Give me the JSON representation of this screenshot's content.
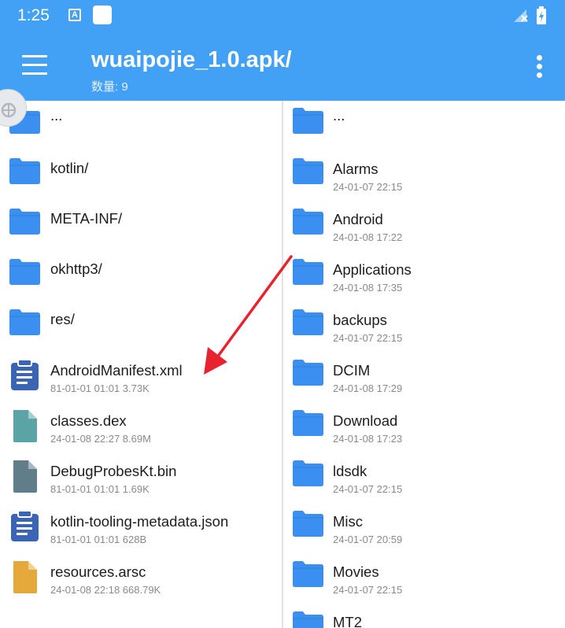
{
  "status": {
    "time": "1:25",
    "notif_letter": "A"
  },
  "appbar": {
    "title": "wuaipojie_1.0.apk/",
    "count": "数量: 9"
  },
  "colors": {
    "bar": "#42a0f5",
    "folder": "#3b8ff0",
    "xml": "#3a64b4",
    "dex": "#5aa4a6",
    "bin": "#607d8a",
    "arsc": "#e4a83b",
    "arrow": "#e8232f"
  },
  "left_pane": [
    {
      "name": "...",
      "meta": "",
      "icon": "folder-icon"
    },
    {
      "name": "kotlin/",
      "meta": "",
      "icon": "folder-icon"
    },
    {
      "name": "META-INF/",
      "meta": "",
      "icon": "folder-icon"
    },
    {
      "name": "okhttp3/",
      "meta": "",
      "icon": "folder-icon"
    },
    {
      "name": "res/",
      "meta": "",
      "icon": "folder-icon"
    },
    {
      "name": "AndroidManifest.xml",
      "meta": "81-01-01 01:01  3.73K",
      "icon": "xml-clipboard-icon"
    },
    {
      "name": "classes.dex",
      "meta": "24-01-08 22:27  8.69M",
      "icon": "dex-file-icon"
    },
    {
      "name": "DebugProbesKt.bin",
      "meta": "81-01-01 01:01  1.69K",
      "icon": "bin-file-icon"
    },
    {
      "name": "kotlin-tooling-metadata.json",
      "meta": "81-01-01 01:01  628B",
      "icon": "json-clipboard-icon"
    },
    {
      "name": "resources.arsc",
      "meta": "24-01-08 22:18  668.79K",
      "icon": "arsc-file-icon"
    }
  ],
  "right_pane": [
    {
      "name": "...",
      "meta": "",
      "icon": "folder-icon"
    },
    {
      "name": "Alarms",
      "meta": "24-01-07 22:15",
      "icon": "folder-icon"
    },
    {
      "name": "Android",
      "meta": "24-01-08 17:22",
      "icon": "folder-icon"
    },
    {
      "name": "Applications",
      "meta": "24-01-08 17:35",
      "icon": "folder-icon"
    },
    {
      "name": "backups",
      "meta": "24-01-07 22:15",
      "icon": "folder-icon"
    },
    {
      "name": "DCIM",
      "meta": "24-01-08 17:29",
      "icon": "folder-icon"
    },
    {
      "name": "Download",
      "meta": "24-01-08 17:23",
      "icon": "folder-icon"
    },
    {
      "name": "ldsdk",
      "meta": "24-01-07 22:15",
      "icon": "folder-icon"
    },
    {
      "name": "Misc",
      "meta": "24-01-07 20:59",
      "icon": "folder-icon"
    },
    {
      "name": "Movies",
      "meta": "24-01-07 22:15",
      "icon": "folder-icon"
    },
    {
      "name": "MT2",
      "meta": "",
      "icon": "folder-icon"
    }
  ]
}
